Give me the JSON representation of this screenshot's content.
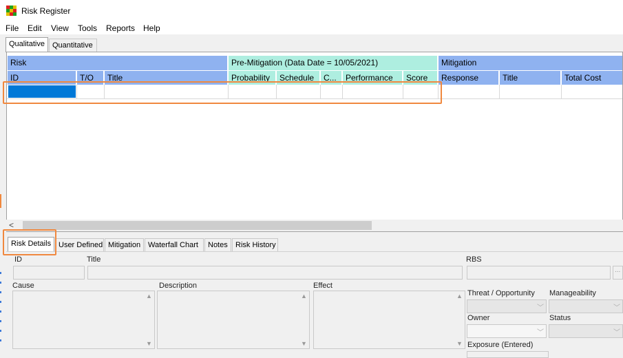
{
  "window": {
    "title": "Risk Register"
  },
  "icon_colors": [
    "#e02020",
    "#20a020",
    "#e0c000",
    "#20a020",
    "#e0c000",
    "#e02020",
    "#e0c000",
    "#e02020",
    "#20a020"
  ],
  "menu": [
    "File",
    "Edit",
    "View",
    "Tools",
    "Reports",
    "Help"
  ],
  "top_tabs": [
    "Qualitative",
    "Quantitative"
  ],
  "grid": {
    "groups": {
      "risk": "Risk",
      "pre_mitigation": "Pre-Mitigation (Data Date = 10/05/2021)",
      "mitigation": "Mitigation"
    },
    "columns": {
      "id": "ID",
      "to": "T/O",
      "title": "Title",
      "probability": "Probability",
      "schedule": "Schedule",
      "cost": "C...",
      "performance": "Performance",
      "score": "Score",
      "response": "Response",
      "mit_title": "Title",
      "total_cost": "Total Cost"
    },
    "scroll_left_glyph": "<"
  },
  "lower_tabs": [
    "Risk Details",
    "User Defined",
    "Mitigation",
    "Waterfall Chart",
    "Notes",
    "Risk History"
  ],
  "details": {
    "id_label": "ID",
    "title_label": "Title",
    "rbs_label": "RBS",
    "rbs_button": "...",
    "cause_label": "Cause",
    "description_label": "Description",
    "effect_label": "Effect",
    "threat_label": "Threat / Opportunity",
    "manageability_label": "Manageability",
    "owner_label": "Owner",
    "status_label": "Status",
    "exposure_label": "Exposure (Entered)"
  },
  "accent_colors": {
    "highlight": "#f0883e",
    "selection": "#0078d7",
    "header_blue": "#8fb2f0",
    "header_cyan": "#aeeee0"
  }
}
